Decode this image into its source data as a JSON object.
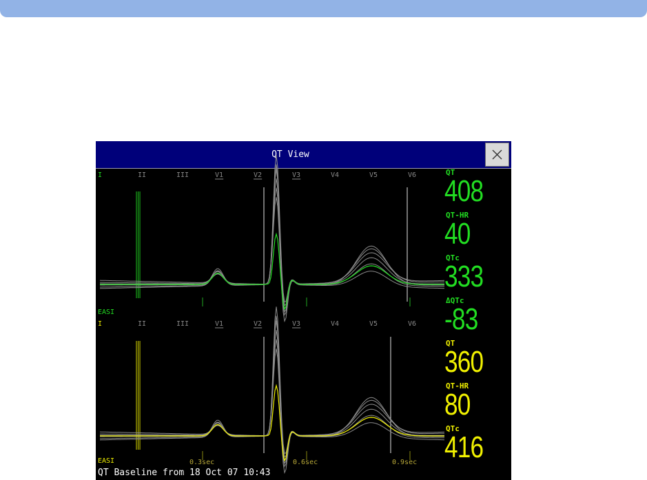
{
  "window": {
    "title": "QT View",
    "footer": "QT Baseline from 18 Oct 07 10:43"
  },
  "lead_labels": [
    "I",
    "II",
    "III",
    "V1",
    "V2",
    "V3",
    "V4",
    "V5",
    "V6"
  ],
  "panels": [
    {
      "selected_lead": "I",
      "mode_label": "EASI",
      "color": "#22dd22",
      "readings": [
        {
          "label": "QT",
          "value": "408"
        },
        {
          "label": "QT-HR",
          "value": "40"
        },
        {
          "label": "QTc",
          "value": "333"
        },
        {
          "label": "ΔQTc",
          "value": "-83"
        }
      ]
    },
    {
      "selected_lead": "I",
      "mode_label": "EASI",
      "color": "#f0f000",
      "time_markers": [
        "0.3sec",
        "0.6sec",
        "0.9sec"
      ],
      "readings": [
        {
          "label": "QT",
          "value": "360"
        },
        {
          "label": "QT-HR",
          "value": "80"
        },
        {
          "label": "QTc",
          "value": "416"
        }
      ]
    }
  ],
  "colors": {
    "current_trace": "#22dd22",
    "baseline_trace": "#f0f000",
    "lead_label_inactive": "#8a8a8a",
    "title_bar": "#00007a",
    "header_strip": "#92b3e6"
  },
  "icons": {
    "close": "close-x-icon"
  }
}
